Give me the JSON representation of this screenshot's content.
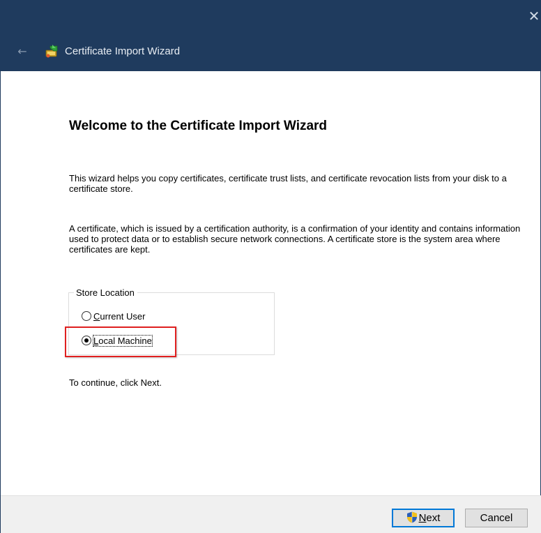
{
  "window": {
    "title": "Certificate Import Wizard",
    "close_glyph": "✕",
    "back_glyph": "←"
  },
  "heading": "Welcome to the Certificate Import Wizard",
  "intro_text": "This wizard helps you copy certificates, certificate trust lists, and certificate revocation lists from your disk to a certificate store.",
  "description_text": "A certificate, which is issued by a certification authority, is a confirmation of your identity and contains information used to protect data or to establish secure network connections. A certificate store is the system area where certificates are kept.",
  "store_location": {
    "legend": "Store Location",
    "options": [
      {
        "label_mnemonic": "C",
        "label_rest": "urrent User",
        "selected": false
      },
      {
        "label_mnemonic": "L",
        "label_rest": "ocal Machine",
        "selected": true
      }
    ]
  },
  "continue_text": "To continue, click Next.",
  "buttons": {
    "next_mnemonic": "N",
    "next_rest": "ext",
    "cancel": "Cancel"
  },
  "colors": {
    "titlebar": "#1f3b5e",
    "highlight": "#e02020",
    "default_button_border": "#0078d7"
  },
  "icons": {
    "wizard": "certificate-wizard-icon",
    "next_button": "uac-shield-icon"
  }
}
